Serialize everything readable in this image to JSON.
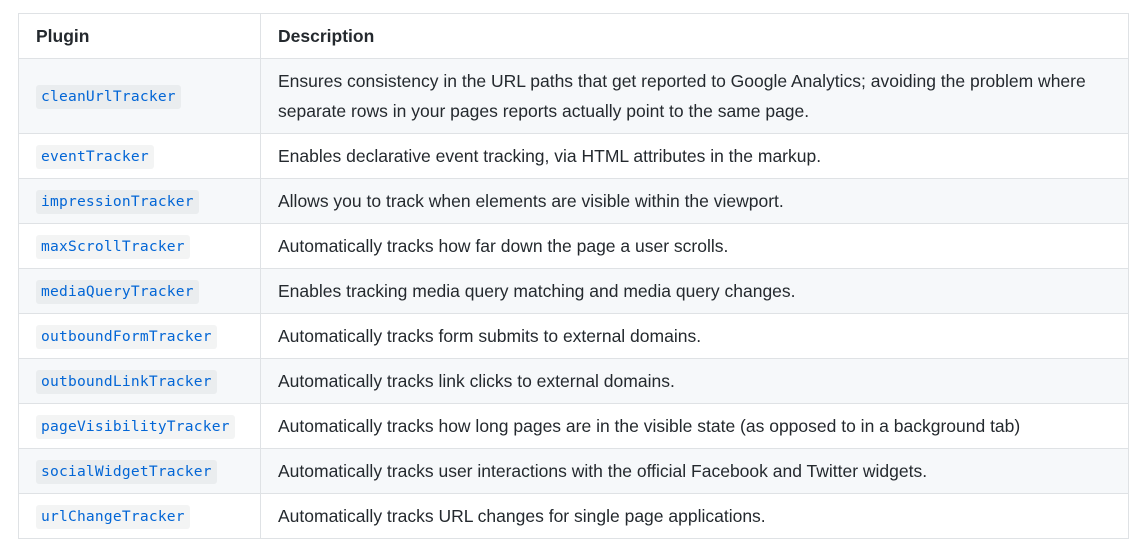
{
  "table": {
    "headers": {
      "plugin": "Plugin",
      "description": "Description"
    },
    "rows": [
      {
        "plugin": "cleanUrlTracker",
        "description": "Ensures consistency in the URL paths that get reported to Google Analytics; avoiding the problem where separate rows in your pages reports actually point to the same page."
      },
      {
        "plugin": "eventTracker",
        "description": "Enables declarative event tracking, via HTML attributes in the markup."
      },
      {
        "plugin": "impressionTracker",
        "description": "Allows you to track when elements are visible within the viewport."
      },
      {
        "plugin": "maxScrollTracker",
        "description": "Automatically tracks how far down the page a user scrolls."
      },
      {
        "plugin": "mediaQueryTracker",
        "description": "Enables tracking media query matching and media query changes."
      },
      {
        "plugin": "outboundFormTracker",
        "description": "Automatically tracks form submits to external domains."
      },
      {
        "plugin": "outboundLinkTracker",
        "description": "Automatically tracks link clicks to external domains."
      },
      {
        "plugin": "pageVisibilityTracker",
        "description": "Automatically tracks how long pages are in the visible state (as opposed to in a background tab)"
      },
      {
        "plugin": "socialWidgetTracker",
        "description": "Automatically tracks user interactions with the official Facebook and Twitter widgets."
      },
      {
        "plugin": "urlChangeTracker",
        "description": "Automatically tracks URL changes for single page applications."
      }
    ]
  },
  "colors": {
    "code_text": "#0366d6",
    "border": "#dfe2e5",
    "stripe": "#f6f8fa",
    "text": "#24292e"
  }
}
